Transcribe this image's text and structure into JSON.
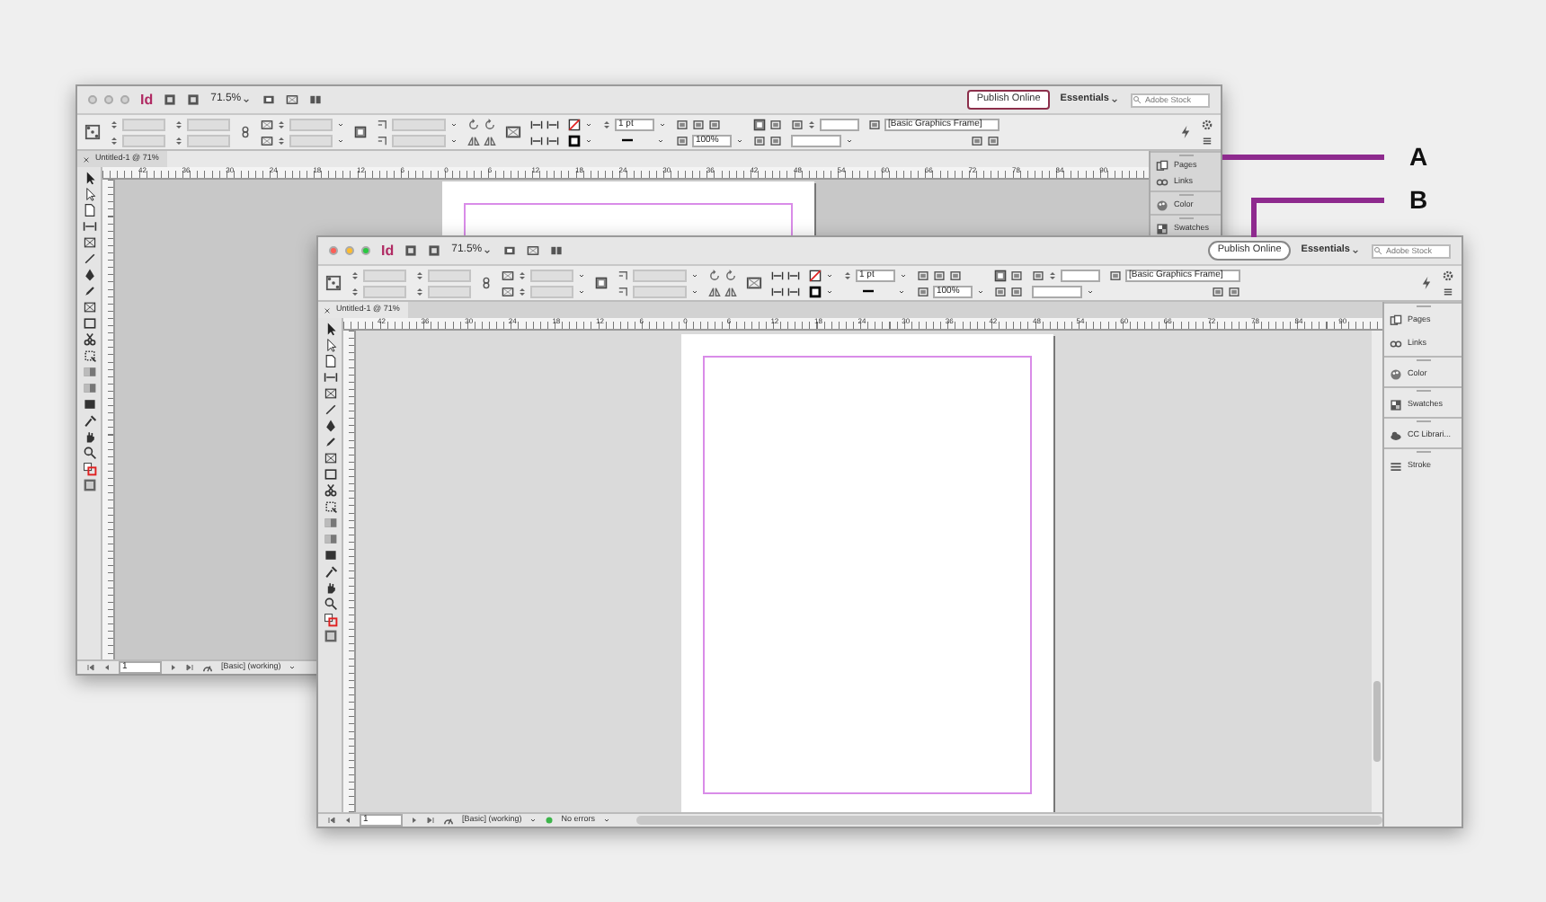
{
  "callouts": [
    {
      "label": "A"
    },
    {
      "label": "B"
    }
  ],
  "windows": [
    {
      "kind": "back",
      "app_logo": "Id",
      "zoom": "71.5%",
      "publish_button": "Publish Online",
      "workspace": "Essentials",
      "search": {
        "placeholder": "Adobe Stock"
      },
      "stroke_weight": "1 pt",
      "scale": "100%",
      "object_style": "[Basic Graphics Frame]",
      "document_tab": "Untitled-1 @ 71%",
      "ruler_labels": [
        "42",
        "36",
        "30",
        "24",
        "18",
        "12",
        "6",
        "0",
        "6",
        "12",
        "18",
        "24",
        "30",
        "36",
        "42",
        "48",
        "54",
        "60",
        "66",
        "72",
        "78",
        "84",
        "90"
      ],
      "panels": [
        {
          "label": "Pages"
        },
        {
          "label": "Links"
        },
        {
          "label": "Color"
        },
        {
          "label": "Swatches"
        }
      ],
      "status_bar": {
        "page": "1",
        "preflight_profile": "[Basic] (working)"
      }
    },
    {
      "kind": "front",
      "app_logo": "Id",
      "zoom": "71.5%",
      "publish_button": "Publish Online",
      "workspace": "Essentials",
      "search": {
        "placeholder": "Adobe Stock"
      },
      "stroke_weight": "1 pt",
      "scale": "100%",
      "object_style": "[Basic Graphics Frame]",
      "document_tab": "Untitled-1 @ 71%",
      "ruler_labels": [
        "42",
        "36",
        "30",
        "24",
        "18",
        "12",
        "6",
        "0",
        "6",
        "12",
        "18",
        "24",
        "30",
        "36",
        "42",
        "48",
        "54",
        "60",
        "66",
        "72",
        "78",
        "84",
        "90"
      ],
      "panels": [
        {
          "label": "Pages"
        },
        {
          "label": "Links"
        },
        {
          "label": "Color"
        },
        {
          "label": "Swatches"
        },
        {
          "label": "CC Librari..."
        },
        {
          "label": "Stroke"
        }
      ],
      "status_bar": {
        "page": "1",
        "preflight_profile": "[Basic] (working)",
        "errors": "No errors"
      }
    }
  ]
}
